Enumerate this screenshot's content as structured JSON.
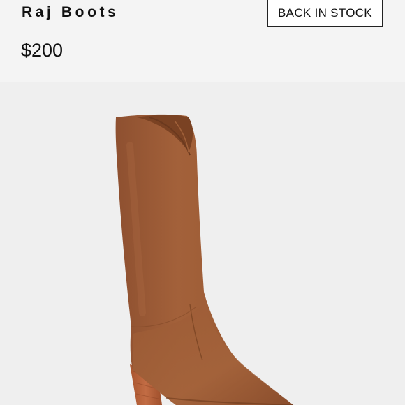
{
  "product": {
    "name": "Raj Boots",
    "price": "$200",
    "stock_status": "BACK IN STOCK",
    "image_subject": "boot-image",
    "colors": {
      "suede": "#9a5a34",
      "suede_shadow": "#7d4526",
      "suede_light": "#b06d43",
      "heel": "#b9653f",
      "background": "#f2f2f2"
    }
  }
}
